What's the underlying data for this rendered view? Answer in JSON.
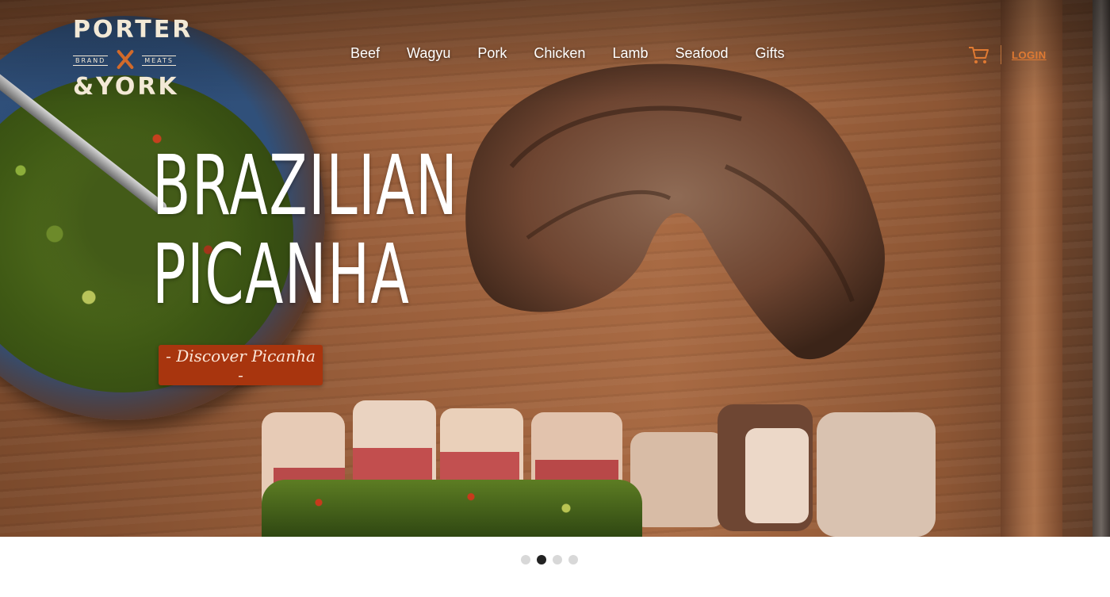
{
  "brand": {
    "line1": "PORTER",
    "line2": "&YORK",
    "left_tag": "BRAND",
    "right_tag": "MEATS"
  },
  "nav": {
    "items": [
      {
        "label": "Beef"
      },
      {
        "label": "Wagyu"
      },
      {
        "label": "Pork"
      },
      {
        "label": "Chicken"
      },
      {
        "label": "Lamb"
      },
      {
        "label": "Seafood"
      },
      {
        "label": "Gifts"
      }
    ]
  },
  "header": {
    "cart_icon": "cart-icon",
    "login_label": "LOGIN",
    "accent_color": "#e07a32"
  },
  "hero": {
    "title_line1": "BRAZILIAN",
    "title_line2": "PICANHA",
    "cta_label": "- Discover Picanha -",
    "cta_color": "#a8350e"
  },
  "carousel": {
    "slide_count": 4,
    "active_index": 1
  }
}
